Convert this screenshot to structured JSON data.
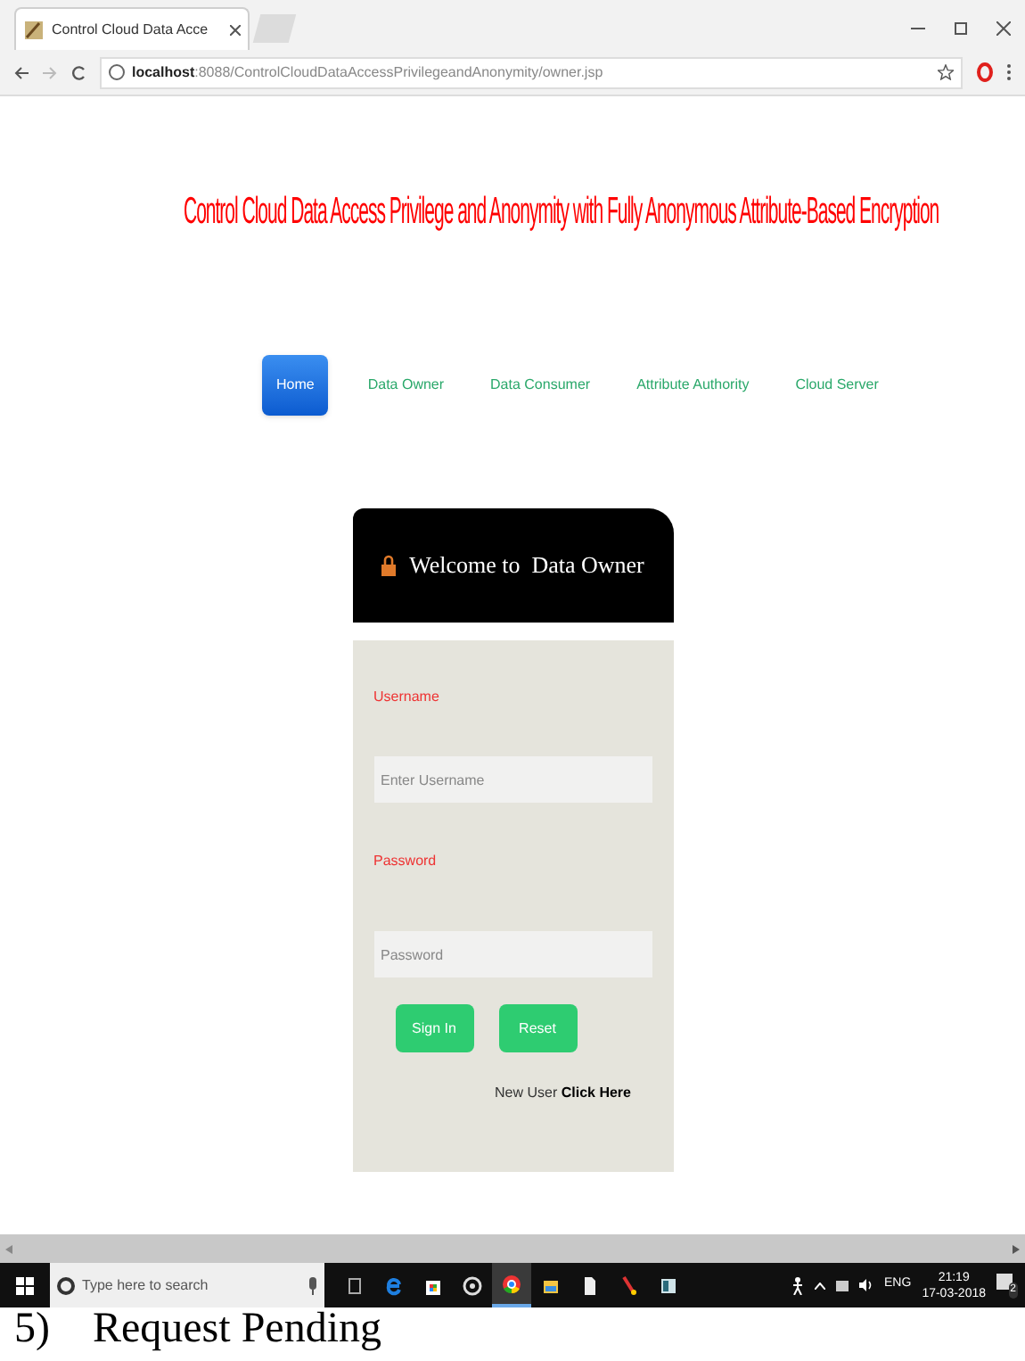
{
  "browser": {
    "tab_title": "Control Cloud Data Acce",
    "url_host": "localhost",
    "url_path": ":8088/ControlCloudDataAccessPrivilegeandAnonymity/owner.jsp"
  },
  "page": {
    "title": "Control Cloud Data Access Privilege and Anonymity with Fully Anonymous Attribute-Based Encryption",
    "nav": [
      {
        "label": "Home",
        "selected": true
      },
      {
        "label": "Data Owner",
        "selected": false
      },
      {
        "label": "Data Consumer",
        "selected": false
      },
      {
        "label": "Attribute Authority",
        "selected": false
      },
      {
        "label": "Cloud Server",
        "selected": false
      }
    ],
    "login": {
      "heading": "Welcome to  Data Owner",
      "username_label": "Username",
      "username_placeholder": "Enter Username",
      "password_label": "Password",
      "password_placeholder": "Password",
      "buttons": [
        "Sign In",
        "Reset"
      ],
      "new_user_text": "New User",
      "new_user_link": "Click Here"
    }
  },
  "taskbar": {
    "search_placeholder": "Type here to search",
    "apps": [
      {
        "kind": "taskview",
        "selected": false
      },
      {
        "kind": "edge",
        "selected": false
      },
      {
        "kind": "store",
        "selected": false
      },
      {
        "kind": "groove",
        "selected": false
      },
      {
        "kind": "chrome",
        "selected": true
      },
      {
        "kind": "explorer",
        "selected": false
      },
      {
        "kind": "file",
        "selected": false
      },
      {
        "kind": "paint",
        "selected": false
      },
      {
        "kind": "app",
        "selected": false
      }
    ],
    "language": "ENG",
    "time": "21:19",
    "date": "17-03-2018",
    "notifications": "2"
  },
  "caption": "5)    Request Pending"
}
